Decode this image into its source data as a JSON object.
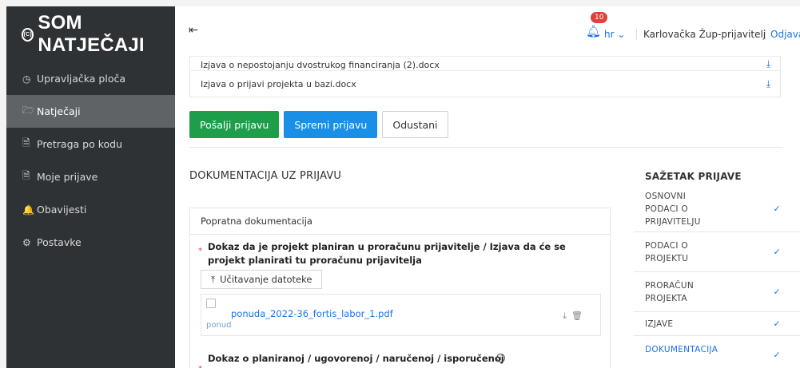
{
  "app": {
    "logo_text": "SOM NATJEČAJI",
    "logo_mark": "(C)"
  },
  "sidebar": {
    "items": [
      {
        "icon": "dashboard-icon",
        "glyph": "◷",
        "label": "Upravljačka ploča"
      },
      {
        "icon": "folder-icon",
        "glyph": "🗁",
        "label": "Natječaji"
      },
      {
        "icon": "document-search-icon",
        "glyph": "🗎",
        "label": "Pretraga po kodu"
      },
      {
        "icon": "document-icon",
        "glyph": "🗎",
        "label": "Moje prijave"
      },
      {
        "icon": "bell-icon",
        "glyph": "🔔",
        "label": "Obavijesti"
      },
      {
        "icon": "gear-icon",
        "glyph": "⚙",
        "label": "Postavke"
      }
    ]
  },
  "topbar": {
    "notification_count": "10",
    "language": "hr",
    "user": "Karlovačka Žup-prijavitelj",
    "logout": "Odjava"
  },
  "doc_list": {
    "rows": [
      {
        "name": "Izjava o nepostojanju dvostrukog financiranja (2).docx"
      },
      {
        "name": "Izjava o prijavi projekta u bazi.docx"
      }
    ]
  },
  "actions": {
    "send": "Pošalji prijavu",
    "save": "Spremi prijavu",
    "cancel": "Odustani"
  },
  "documentation": {
    "title": "DOKUMENTACIJA UZ PRIJAVU",
    "card_title": "Popratna dokumentacija",
    "field1_line1": "Dokaz da je projekt planiran u proračunu prijavitelje / Izjava da će se",
    "field1_line2": "projekt planirati tu proračunu prijavitelja",
    "upload_label": "Učitavanje datoteke",
    "file_name": "ponuda_2022-36_fortis_labor_1.pdf",
    "file_alt": "ponud",
    "field2_line1": "Dokaz o planiranoj / ugovorenoj / naručenoj / isporučenoj",
    "required_mark": "*"
  },
  "summary": {
    "title": "SAŽETAK PRIJAVE",
    "items": [
      {
        "label": "OSNOVNI PODACI O PRIJAVITELJU",
        "done": true
      },
      {
        "label": "PODACI O PROJEKTU",
        "done": true
      },
      {
        "label": "PRORAČUN PROJEKTA",
        "done": true
      },
      {
        "label": "IZJAVE",
        "done": true
      },
      {
        "label": "DOKUMENTACIJA",
        "done": true
      }
    ],
    "check_glyph": "✓"
  }
}
